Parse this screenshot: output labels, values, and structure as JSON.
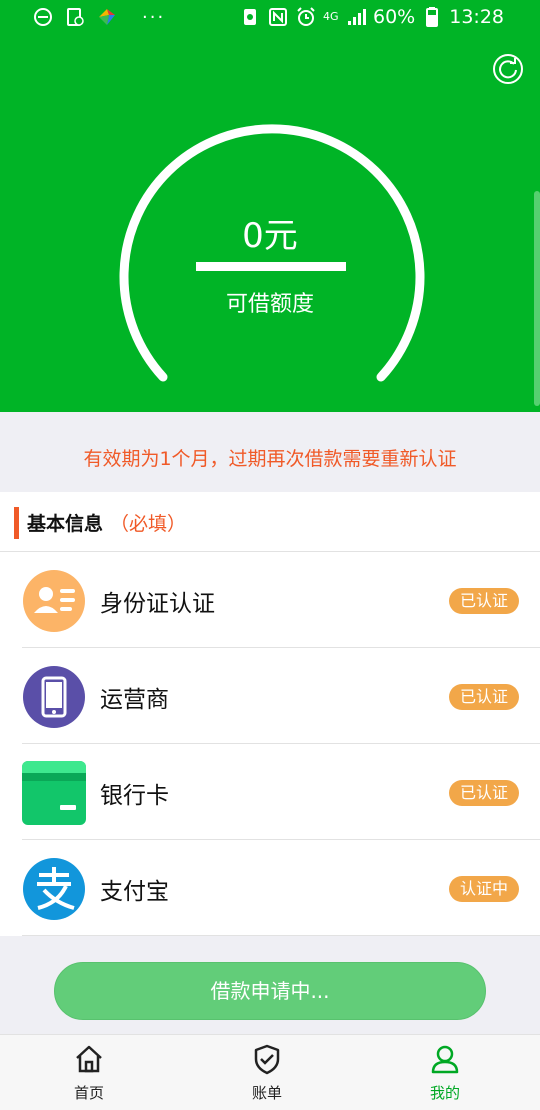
{
  "statusbar": {
    "dots": "···",
    "battery": "60%",
    "time": "13:28",
    "network": "4G",
    "icons": [
      "minus-circle-icon",
      "screen-record-icon",
      "app-logo-icon",
      "recycle-icon",
      "nfc-icon",
      "alarm-icon",
      "signal-icon",
      "battery-icon"
    ]
  },
  "hero": {
    "amount": "0元",
    "amount_label": "可借额度",
    "refresh_icon": "refresh-icon",
    "colors": {
      "background": "#00b426",
      "gauge": "#ffffff"
    }
  },
  "notice": {
    "text": "有效期为1个月，过期再次借款需要重新认证",
    "color": "#f05a28"
  },
  "section": {
    "title": "基本信息",
    "required": "（必填）"
  },
  "items": [
    {
      "label": "身份证认证",
      "badge": "已认证",
      "icon": "id-card-icon"
    },
    {
      "label": "运营商",
      "badge": "已认证",
      "icon": "mobile-phone-icon"
    },
    {
      "label": "银行卡",
      "badge": "已认证",
      "icon": "bank-card-icon"
    },
    {
      "label": "支付宝",
      "badge": "认证中",
      "icon": "alipay-icon"
    }
  ],
  "apply_button": {
    "label": "借款申请中..."
  },
  "tabs": [
    {
      "label": "首页",
      "icon": "home-icon",
      "active": false
    },
    {
      "label": "账单",
      "icon": "shield-check-icon",
      "active": false
    },
    {
      "label": "我的",
      "icon": "user-icon",
      "active": true
    }
  ]
}
